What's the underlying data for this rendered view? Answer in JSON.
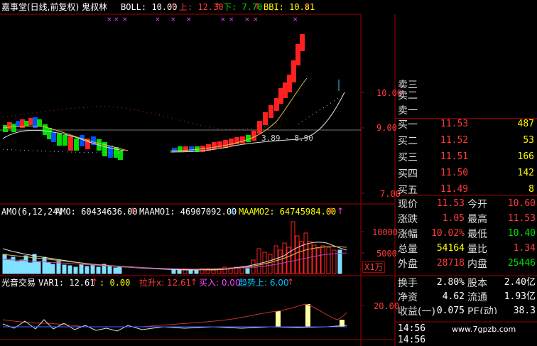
{
  "header": {
    "title": "嘉事堂(日线,前复权) 鬼叔林",
    "boll": "BOLL: 10.00",
    "upper": "上: 12.30",
    "lower": "下: 7.70",
    "bbi": "BBI: 10.81"
  },
  "price_axis": {
    "ticks": [
      "10.00",
      "9.00",
      "7.00"
    ]
  },
  "level_label": "3.89 - 8.90",
  "amo": {
    "name": "AMO(6,12,24)",
    "amo": "AMO: 60434636.00",
    "maamo1": "MAAMO1: 46907092.00",
    "maamo2": "MAAMO2: 64745984.00",
    "ticks": [
      "10000",
      "5000"
    ],
    "unit": "X1万"
  },
  "signal": {
    "name": "光音交易",
    "var1": "VAR1: 12.61",
    "val0": ": 0.00",
    "lasheng": "拉升x: 12.61",
    "mairu": "买入: 0.00",
    "qushi": "趋势上: 6.00",
    "tick": "20.00"
  },
  "orderbook": {
    "sell_partial": [
      "卖三",
      "卖二",
      "卖一"
    ],
    "buy": [
      {
        "label": "买一",
        "price": "11.53",
        "vol": "487"
      },
      {
        "label": "买二",
        "price": "11.52",
        "vol": "53"
      },
      {
        "label": "买三",
        "price": "11.51",
        "vol": "166"
      },
      {
        "label": "买四",
        "price": "11.50",
        "vol": "142"
      },
      {
        "label": "买五",
        "price": "11.49",
        "vol": "8"
      }
    ]
  },
  "quote": [
    {
      "l1": "现价",
      "v1": "11.53",
      "c1": "#ff3b3b",
      "l2": "今开",
      "v2": "10.60",
      "c2": "#ff3b3b"
    },
    {
      "l1": "涨跌",
      "v1": "1.05",
      "c1": "#ff3b3b",
      "l2": "最高",
      "v2": "11.53",
      "c2": "#ff3b3b"
    },
    {
      "l1": "涨幅",
      "v1": "10.02%",
      "c1": "#ff3b3b",
      "l2": "最低",
      "v2": "10.40",
      "c2": "#00e000"
    },
    {
      "l1": "总量",
      "v1": "54164",
      "c1": "#ffff00",
      "l2": "量比",
      "v2": "1.34",
      "c2": "#ff3b3b"
    },
    {
      "l1": "外盘",
      "v1": "28718",
      "c1": "#ff3b3b",
      "l2": "内盘",
      "v2": "25446",
      "c2": "#00e000"
    }
  ],
  "stats": [
    {
      "l1": "换手",
      "v1": "2.80%",
      "l2": "股本",
      "v2": "2.40亿"
    },
    {
      "l1": "净资",
      "v1": "4.62",
      "l2": "流通",
      "v2": "1.93亿"
    },
    {
      "l1": "收益(一)",
      "v1": "0.075",
      "l2": "PE(动)",
      "v2": "38.3"
    }
  ],
  "ticks_time": [
    "14:56",
    "14:56"
  ],
  "watermark": "www.7gpzb.com"
}
